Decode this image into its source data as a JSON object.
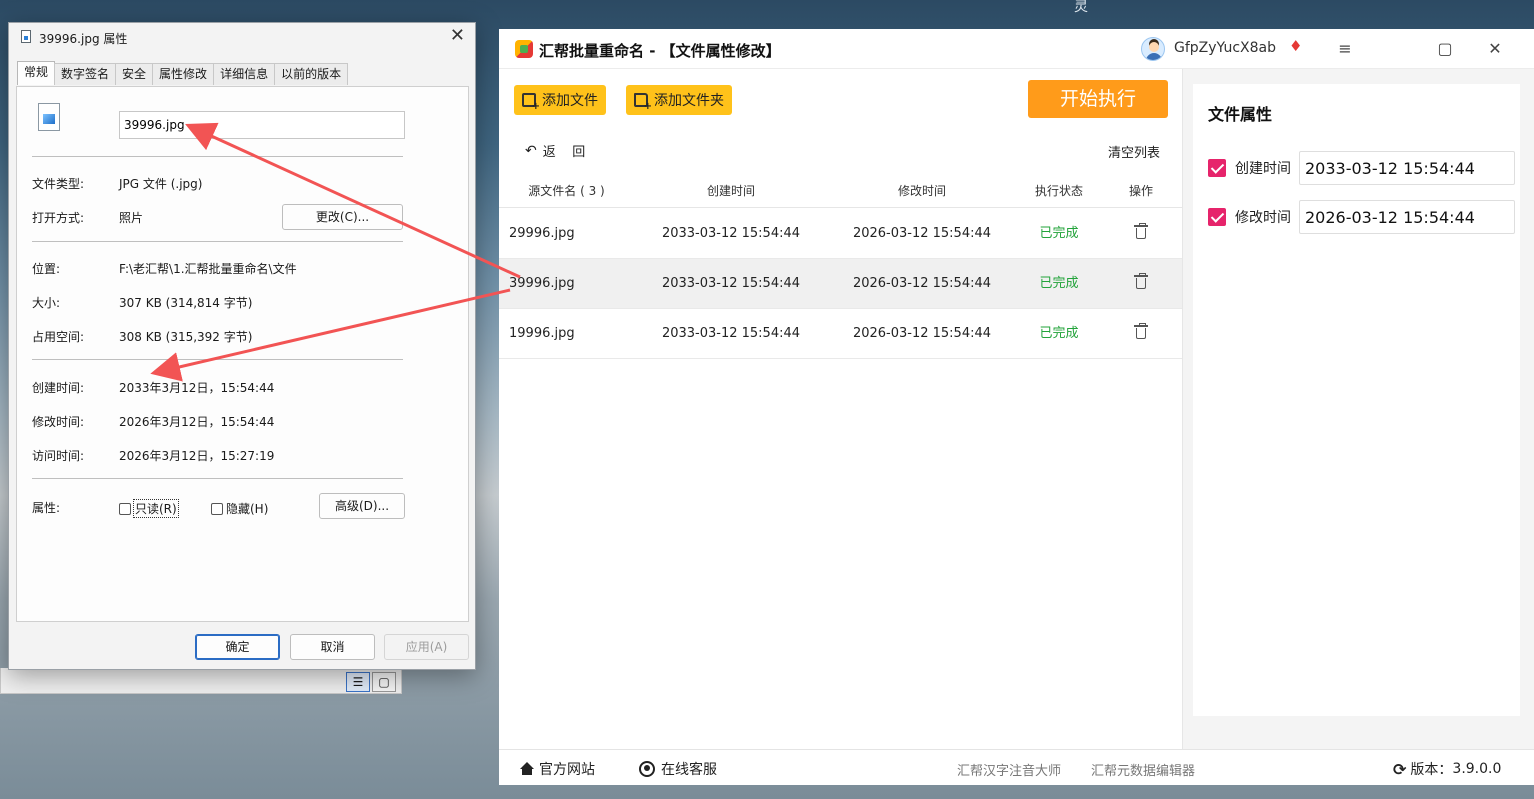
{
  "desktop": {
    "glyph": "灵"
  },
  "dialog": {
    "title": "39996.jpg 属性",
    "tabs": [
      "常规",
      "数字签名",
      "安全",
      "属性修改",
      "详细信息",
      "以前的版本"
    ],
    "filename": "39996.jpg",
    "rows": {
      "type_label": "文件类型:",
      "type_value": "JPG 文件 (.jpg)",
      "open_label": "打开方式:",
      "open_value": "照片",
      "change_btn": "更改(C)...",
      "loc_label": "位置:",
      "loc_value": "F:\\老汇帮\\1.汇帮批量重命名\\文件",
      "size_label": "大小:",
      "size_value": "307 KB (314,814 字节)",
      "disk_label": "占用空间:",
      "disk_value": "308 KB (315,392 字节)",
      "created_label": "创建时间:",
      "created_value": "2033年3月12日，15:54:44",
      "modified_label": "修改时间:",
      "modified_value": "2026年3月12日，15:54:44",
      "accessed_label": "访问时间:",
      "accessed_value": "2026年3月12日，15:27:19",
      "attr_label": "属性:",
      "readonly": "只读(R)",
      "hidden": "隐藏(H)",
      "advanced_btn": "高级(D)..."
    },
    "buttons": {
      "ok": "确定",
      "cancel": "取消",
      "apply": "应用(A)"
    }
  },
  "app": {
    "title": "汇帮批量重命名 - 【文件属性修改】",
    "user": "GfpZyYucX8ab",
    "window_controls": {
      "menu": "≡",
      "maximize": "▢",
      "close": "✕"
    },
    "toolbar": {
      "add_file": "添加文件",
      "add_folder": "添加文件夹",
      "start": "开始执行"
    },
    "back": "返    回",
    "clear_list": "清空列表",
    "columns": [
      "源文件名 ( 3 )",
      "创建时间",
      "修改时间",
      "执行状态",
      "操作"
    ],
    "rows": [
      {
        "name": "29996.jpg",
        "created": "2033-03-12 15:54:44",
        "modified": "2026-03-12 15:54:44",
        "status": "已完成"
      },
      {
        "name": "39996.jpg",
        "created": "2033-03-12 15:54:44",
        "modified": "2026-03-12 15:54:44",
        "status": "已完成"
      },
      {
        "name": "19996.jpg",
        "created": "2033-03-12 15:54:44",
        "modified": "2026-03-12 15:54:44",
        "status": "已完成"
      }
    ],
    "panel": {
      "title": "文件属性",
      "created_label": "创建时间",
      "created_value": "2033-03-12 15:54:44",
      "modified_label": "修改时间",
      "modified_value": "2026-03-12 15:54:44"
    },
    "footer": {
      "website": "官方网站",
      "support": "在线客服",
      "link1": "汇帮汉字注音大师",
      "link2": "汇帮元数据编辑器",
      "version_label": "版本：",
      "version": "3.9.0.0"
    }
  },
  "colors": {
    "accent_yellow": "#ffc21a",
    "start_orange": "#ff9b1a",
    "done_green": "#22a33a",
    "checkbox_pink": "#e6246b",
    "annotation_red": "#f25454"
  }
}
